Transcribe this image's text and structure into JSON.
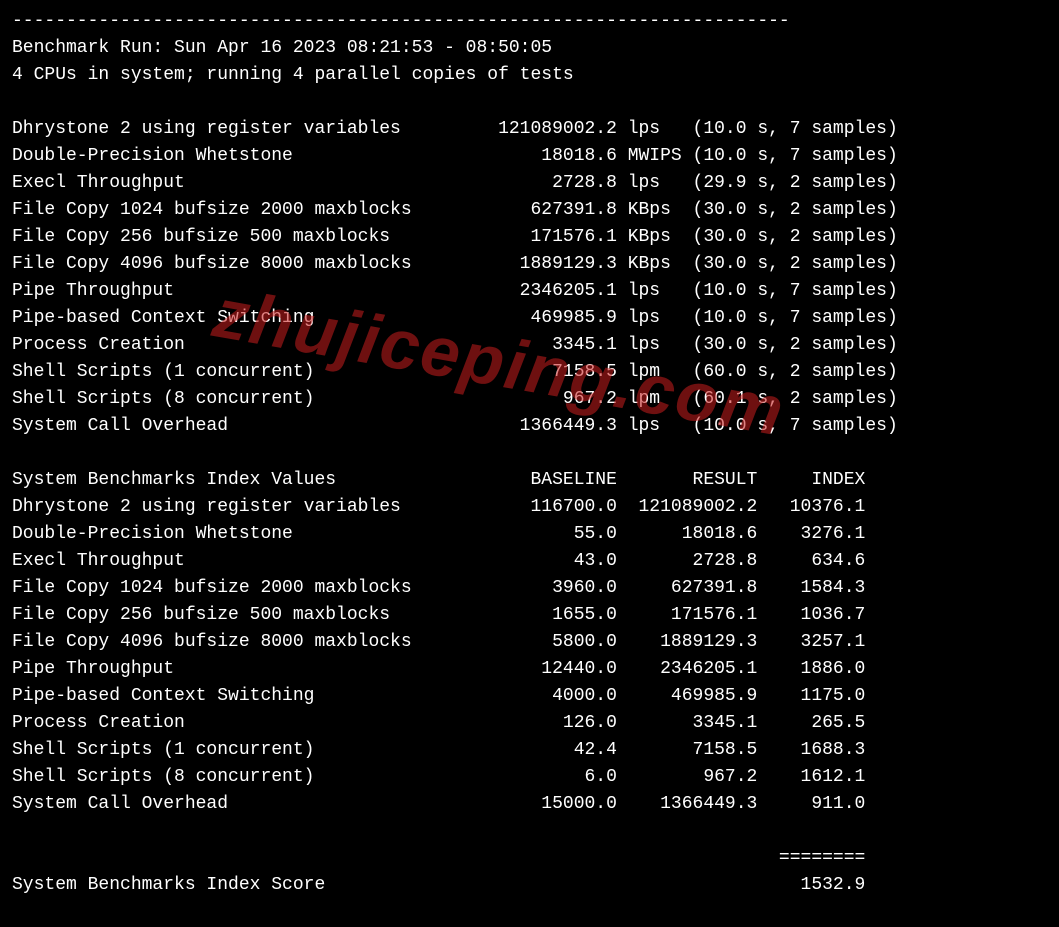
{
  "divider": "------------------------------------------------------------------------",
  "run_line": "Benchmark Run: Sun Apr 16 2023 08:21:53 - 08:50:05",
  "cpu_line": "4 CPUs in system; running 4 parallel copies of tests",
  "tests": [
    {
      "name": "Dhrystone 2 using register variables",
      "value": "121089002.2",
      "unit": "lps",
      "time": "10.0",
      "samples": "7"
    },
    {
      "name": "Double-Precision Whetstone",
      "value": "18018.6",
      "unit": "MWIPS",
      "time": "10.0",
      "samples": "7"
    },
    {
      "name": "Execl Throughput",
      "value": "2728.8",
      "unit": "lps",
      "time": "29.9",
      "samples": "2"
    },
    {
      "name": "File Copy 1024 bufsize 2000 maxblocks",
      "value": "627391.8",
      "unit": "KBps",
      "time": "30.0",
      "samples": "2"
    },
    {
      "name": "File Copy 256 bufsize 500 maxblocks",
      "value": "171576.1",
      "unit": "KBps",
      "time": "30.0",
      "samples": "2"
    },
    {
      "name": "File Copy 4096 bufsize 8000 maxblocks",
      "value": "1889129.3",
      "unit": "KBps",
      "time": "30.0",
      "samples": "2"
    },
    {
      "name": "Pipe Throughput",
      "value": "2346205.1",
      "unit": "lps",
      "time": "10.0",
      "samples": "7"
    },
    {
      "name": "Pipe-based Context Switching",
      "value": "469985.9",
      "unit": "lps",
      "time": "10.0",
      "samples": "7"
    },
    {
      "name": "Process Creation",
      "value": "3345.1",
      "unit": "lps",
      "time": "30.0",
      "samples": "2"
    },
    {
      "name": "Shell Scripts (1 concurrent)",
      "value": "7158.5",
      "unit": "lpm",
      "time": "60.0",
      "samples": "2"
    },
    {
      "name": "Shell Scripts (8 concurrent)",
      "value": "967.2",
      "unit": "lpm",
      "time": "60.1",
      "samples": "2"
    },
    {
      "name": "System Call Overhead",
      "value": "1366449.3",
      "unit": "lps",
      "time": "10.0",
      "samples": "7"
    }
  ],
  "index_header": {
    "label": "System Benchmarks Index Values",
    "baseline": "BASELINE",
    "result": "RESULT",
    "index": "INDEX"
  },
  "index_rows": [
    {
      "name": "Dhrystone 2 using register variables",
      "baseline": "116700.0",
      "result": "121089002.2",
      "index": "10376.1"
    },
    {
      "name": "Double-Precision Whetstone",
      "baseline": "55.0",
      "result": "18018.6",
      "index": "3276.1"
    },
    {
      "name": "Execl Throughput",
      "baseline": "43.0",
      "result": "2728.8",
      "index": "634.6"
    },
    {
      "name": "File Copy 1024 bufsize 2000 maxblocks",
      "baseline": "3960.0",
      "result": "627391.8",
      "index": "1584.3"
    },
    {
      "name": "File Copy 256 bufsize 500 maxblocks",
      "baseline": "1655.0",
      "result": "171576.1",
      "index": "1036.7"
    },
    {
      "name": "File Copy 4096 bufsize 8000 maxblocks",
      "baseline": "5800.0",
      "result": "1889129.3",
      "index": "3257.1"
    },
    {
      "name": "Pipe Throughput",
      "baseline": "12440.0",
      "result": "2346205.1",
      "index": "1886.0"
    },
    {
      "name": "Pipe-based Context Switching",
      "baseline": "4000.0",
      "result": "469985.9",
      "index": "1175.0"
    },
    {
      "name": "Process Creation",
      "baseline": "126.0",
      "result": "3345.1",
      "index": "265.5"
    },
    {
      "name": "Shell Scripts (1 concurrent)",
      "baseline": "42.4",
      "result": "7158.5",
      "index": "1688.3"
    },
    {
      "name": "Shell Scripts (8 concurrent)",
      "baseline": "6.0",
      "result": "967.2",
      "index": "1612.1"
    },
    {
      "name": "System Call Overhead",
      "baseline": "15000.0",
      "result": "1366449.3",
      "index": "911.0"
    }
  ],
  "score_divider": "========",
  "score_label": "System Benchmarks Index Score",
  "score_value": "1532.9",
  "watermark": "zhujiceping.com"
}
